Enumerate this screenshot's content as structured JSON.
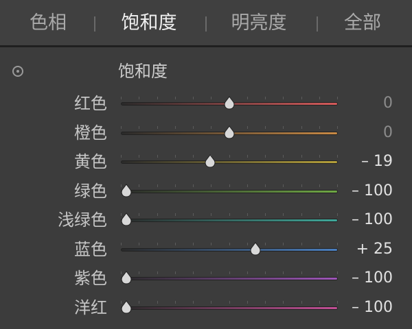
{
  "tabs": [
    {
      "label": "色相",
      "active": false
    },
    {
      "label": "饱和度",
      "active": true
    },
    {
      "label": "明亮度",
      "active": false
    },
    {
      "label": "全部",
      "active": false
    }
  ],
  "panel": {
    "target_tool_icon": "target-adjustment-icon",
    "section_title": "饱和度",
    "range": [
      -100,
      100
    ],
    "sliders": [
      {
        "id": "red",
        "label": "红色",
        "value": 0,
        "display": "0",
        "track_color": "#d45a5a",
        "track_start": "#2a2a2a"
      },
      {
        "id": "orange",
        "label": "橙色",
        "value": 0,
        "display": "0",
        "track_color": "#c98a45",
        "track_start": "#2a2a2a"
      },
      {
        "id": "yellow",
        "label": "黄色",
        "value": -19,
        "display": "– 19",
        "track_color": "#b5a03a",
        "track_start": "#2a2a2a"
      },
      {
        "id": "green",
        "label": "绿色",
        "value": -100,
        "display": "– 100",
        "track_color": "#6fa844",
        "track_start": "#2a2a2a"
      },
      {
        "id": "aqua",
        "label": "浅绿色",
        "value": -100,
        "display": "– 100",
        "track_color": "#3fa89a",
        "track_start": "#2a2a2a"
      },
      {
        "id": "blue",
        "label": "蓝色",
        "value": 25,
        "display": "+ 25",
        "track_color": "#4a7fc0",
        "track_start": "#2a2a2a"
      },
      {
        "id": "purple",
        "label": "紫色",
        "value": -100,
        "display": "– 100",
        "track_color": "#9d55b8",
        "track_start": "#2a2a2a"
      },
      {
        "id": "magenta",
        "label": "洋红",
        "value": -100,
        "display": "– 100",
        "track_color": "#c24f95",
        "track_start": "#2a2a2a"
      }
    ]
  }
}
